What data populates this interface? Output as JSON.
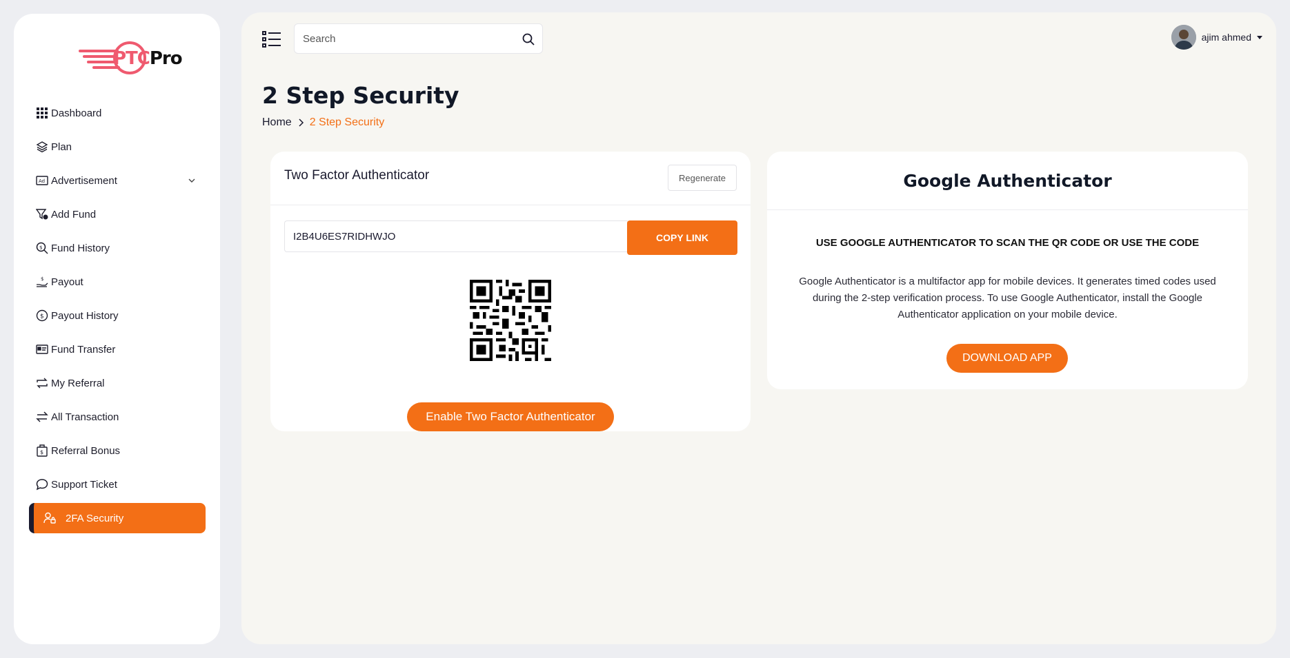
{
  "brand": {
    "logo_part1": "PTC",
    "logo_part2": "Pro"
  },
  "sidebar": {
    "items": [
      {
        "label": "Dashboard",
        "icon": "grid-icon"
      },
      {
        "label": "Plan",
        "icon": "layers-icon"
      },
      {
        "label": "Advertisement",
        "icon": "ad-icon",
        "expandable": true
      },
      {
        "label": "Add Fund",
        "icon": "funnel-dollar-icon"
      },
      {
        "label": "Fund History",
        "icon": "search-dollar-icon"
      },
      {
        "label": "Payout",
        "icon": "hand-dollar-icon"
      },
      {
        "label": "Payout History",
        "icon": "coin-icon"
      },
      {
        "label": "Fund Transfer",
        "icon": "id-card-icon"
      },
      {
        "label": "My Referral",
        "icon": "repeat-icon"
      },
      {
        "label": "All Transaction",
        "icon": "exchange-icon"
      },
      {
        "label": "Referral Bonus",
        "icon": "bag-dollar-icon"
      },
      {
        "label": "Support Ticket",
        "icon": "chat-icon"
      },
      {
        "label": "2FA Security",
        "icon": "user-lock-icon",
        "active": true
      }
    ]
  },
  "topbar": {
    "search_placeholder": "Search",
    "user_name": "ajim ahmed"
  },
  "page": {
    "title": "2 Step Security",
    "breadcrumb_home": "Home",
    "breadcrumb_current": "2 Step Security"
  },
  "two_factor": {
    "title": "Two Factor Authenticator",
    "regenerate_label": "Regenerate",
    "secret_code": "I2B4U6ES7RIDHWJO",
    "copy_label": "COPY LINK",
    "enable_label": "Enable Two Factor Authenticator"
  },
  "google_auth": {
    "title": "Google Authenticator",
    "instruction": "USE GOOGLE AUTHENTICATOR TO SCAN THE QR CODE OR USE THE CODE",
    "description": "Google Authenticator is a multifactor app for mobile devices. It generates timed codes used during the 2-step verification process. To use Google Authenticator, install the Google Authenticator application on your mobile device.",
    "download_label": "DOWNLOAD APP"
  },
  "colors": {
    "accent": "#f36f16",
    "dark": "#1a1a2e",
    "logo_pink": "#ef5a6f"
  }
}
